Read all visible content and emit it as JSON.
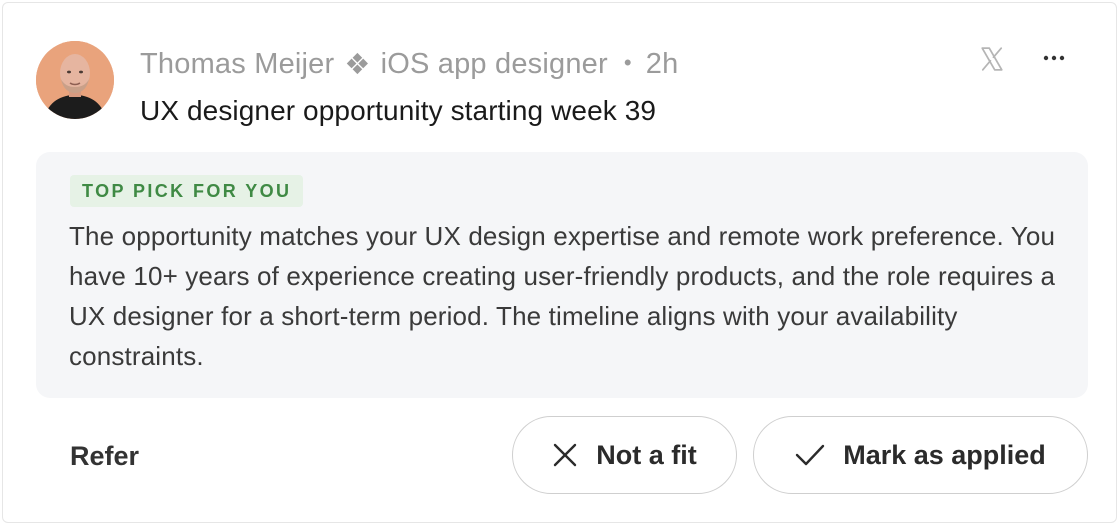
{
  "author": {
    "name": "Thomas Meijer",
    "separator_glyph": "❖",
    "role": "iOS app designer",
    "dot": "•",
    "time_ago": "2h"
  },
  "post": {
    "title": "UX designer opportunity starting week 39"
  },
  "icons": {
    "x_logo": "x-logo-icon",
    "more": "more-icon"
  },
  "insight": {
    "badge": "TOP PICK FOR YOU",
    "text": "The opportunity matches your UX design expertise and remote work preference. You have 10+ years of experience creating user-friendly products, and the role requires a UX designer for a short-term period. The timeline aligns with your availability constraints."
  },
  "actions": {
    "refer": "Refer",
    "not_fit": "Not a fit",
    "mark_applied": "Mark as applied"
  },
  "colors": {
    "badge_bg": "#e6f2e6",
    "badge_text": "#3f8a44",
    "panel_bg": "#f5f6f8",
    "meta_text": "#9b9b9b"
  }
}
